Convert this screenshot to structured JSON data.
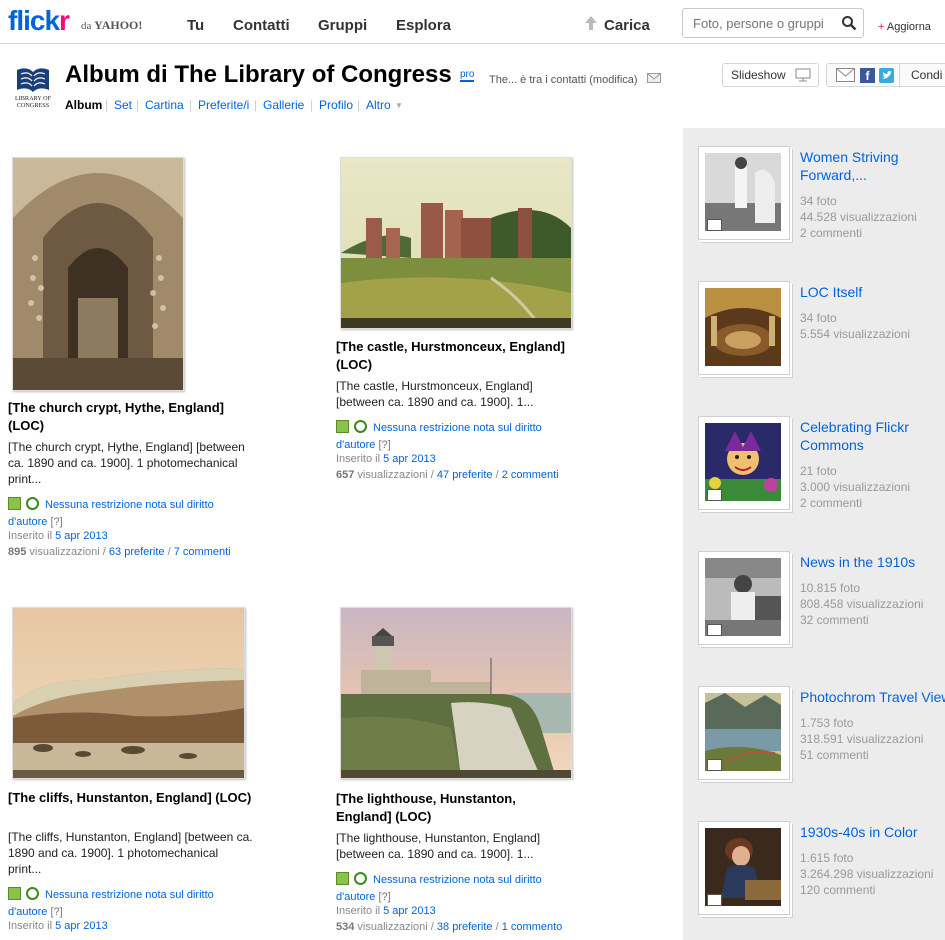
{
  "nav": {
    "logo_main": "flickr",
    "logo_by": "da",
    "logo_yahoo": "YAHOO!",
    "items": [
      "Tu",
      "Contatti",
      "Gruppi",
      "Esplora"
    ],
    "upload": "Carica",
    "search_placeholder": "Foto, persone o gruppi",
    "upgrade": "Aggiorna"
  },
  "header": {
    "logo_text1": "LIBRARY OF",
    "logo_text2": "CONGRESS",
    "title": "Album di The Library of Congress",
    "pro": "pro",
    "contact": "The... è tra i contatti (modifica)",
    "tabs": [
      "Album",
      "Set",
      "Cartina",
      "Preferite/i",
      "Gallerie",
      "Profilo",
      "Altro"
    ],
    "slideshow": "Slideshow",
    "share_label": "Condi"
  },
  "photos": [
    {
      "title": "[The church crypt, Hythe, England] (LOC)",
      "desc": "[The church crypt, Hythe, England] [between ca. 1890 and ca. 1900]. 1 photomechanical print...",
      "license": "Nessuna restrizione nota sul diritto d'autore",
      "q": "[?]",
      "inserted_label": "Inserito il",
      "date": "5 apr 2013",
      "views": "895",
      "views_label": "visualizzazioni /",
      "favs": "63 preferite",
      "comments": "7 commenti"
    },
    {
      "title": "[The castle, Hurstmonceux, England] (LOC)",
      "desc": "[The castle, Hurstmonceux, England] [between ca. 1890 and ca. 1900]. 1...",
      "license": "Nessuna restrizione nota sul diritto d'autore",
      "q": "[?]",
      "inserted_label": "Inserito il",
      "date": "5 apr 2013",
      "views": "657",
      "views_label": "visualizzazioni /",
      "favs": "47 preferite",
      "comments": "2 commenti"
    },
    {
      "title": "[The cliffs, Hunstanton, England] (LOC)",
      "desc": "[The cliffs, Hunstanton, England] [between ca. 1890 and ca. 1900]. 1 photomechanical print...",
      "license": "Nessuna restrizione nota sul diritto d'autore",
      "q": "[?]",
      "inserted_label": "Inserito il",
      "date": "5 apr 2013"
    },
    {
      "title": "[The lighthouse, Hunstanton, England] (LOC)",
      "desc": "[The lighthouse, Hunstanton, England] [between ca. 1890 and ca. 1900]. 1...",
      "license": "Nessuna restrizione nota sul diritto d'autore",
      "q": "[?]",
      "inserted_label": "Inserito il",
      "date": "5 apr 2013",
      "views": "534",
      "views_label": "visualizzazioni /",
      "favs": "38 preferite",
      "comments": "1 commento"
    }
  ],
  "sets": [
    {
      "name1": "Women Striving",
      "name2": "Forward,...",
      "l1": "34 foto",
      "l2": "44.528 visualizzazioni",
      "l3": "2 commenti"
    },
    {
      "name1": "LOC Itself",
      "name2": "",
      "l1": "34 foto",
      "l2": "5.554 visualizzazioni",
      "l3": ""
    },
    {
      "name1": "Celebrating Flickr",
      "name2": "Commons",
      "l1": "21 foto",
      "l2": "3.000 visualizzazioni",
      "l3": "2 commenti"
    },
    {
      "name1": "News in the 1910s",
      "name2": "",
      "l1": "10.815 foto",
      "l2": "808.458 visualizzazioni",
      "l3": "32 commenti"
    },
    {
      "name1": "Photochrom Travel View",
      "name2": "",
      "l1": "1.753 foto",
      "l2": "318.591 visualizzazioni",
      "l3": "51 commenti"
    },
    {
      "name1": "1930s-40s in Color",
      "name2": "",
      "l1": "1.615 foto",
      "l2": "3.264.298 visualizzazioni",
      "l3": "120 commenti"
    }
  ],
  "colors": {
    "link": "#0063dc",
    "pink": "#ff0084",
    "sidebar_bg": "#ececec"
  }
}
